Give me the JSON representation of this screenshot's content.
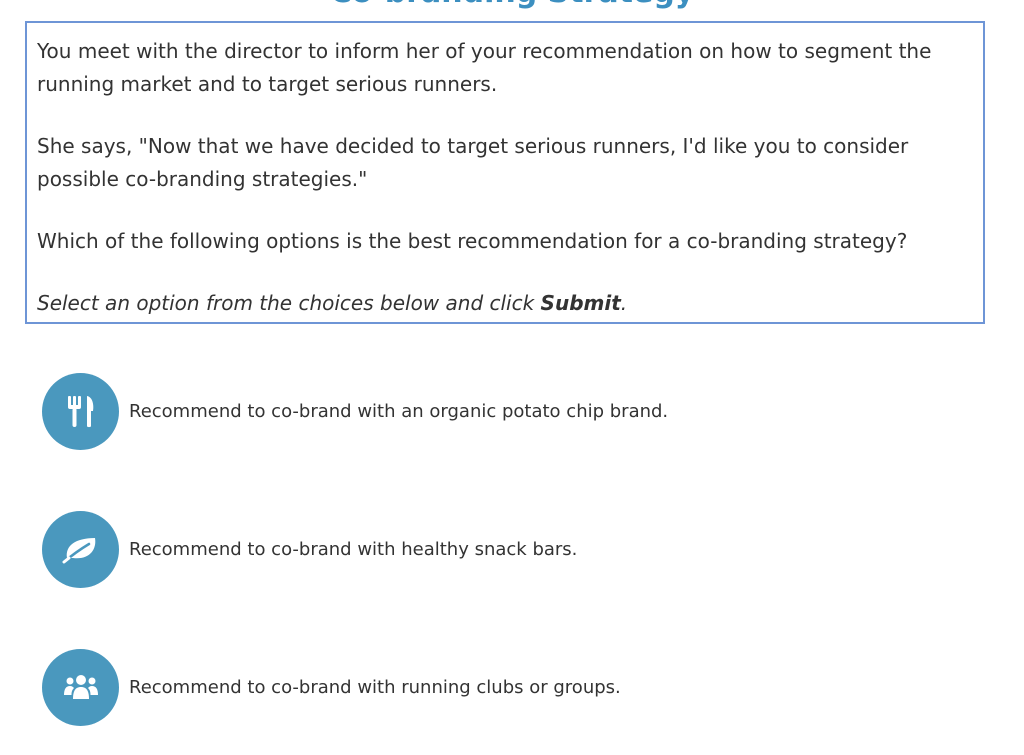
{
  "header": {
    "title": "Co-branding Strategy"
  },
  "prompt": {
    "p1": "You meet with the director to inform her of your recommendation on how to segment the running market and to target serious runners.",
    "p2": "She says, \"Now that we have decided to target serious runners, I'd like you to consider possible co-branding strategies.\"",
    "p3": "Which of the following options is the best recommendation for a co-branding strategy?",
    "instruction_pre": "Select an option from the choices below and click ",
    "instruction_bold": "Submit",
    "instruction_post": "."
  },
  "options": [
    {
      "icon": "utensils-icon",
      "label": "Recommend to co-brand with an organic potato chip brand."
    },
    {
      "icon": "leaf-icon",
      "label": "Recommend to co-brand with healthy snack bars."
    },
    {
      "icon": "group-icon",
      "label": "Recommend to co-brand with running clubs or groups."
    }
  ],
  "colors": {
    "accent": "#4a98be",
    "border": "#6e95d6",
    "title": "#3c8fc0",
    "text": "#333333"
  }
}
